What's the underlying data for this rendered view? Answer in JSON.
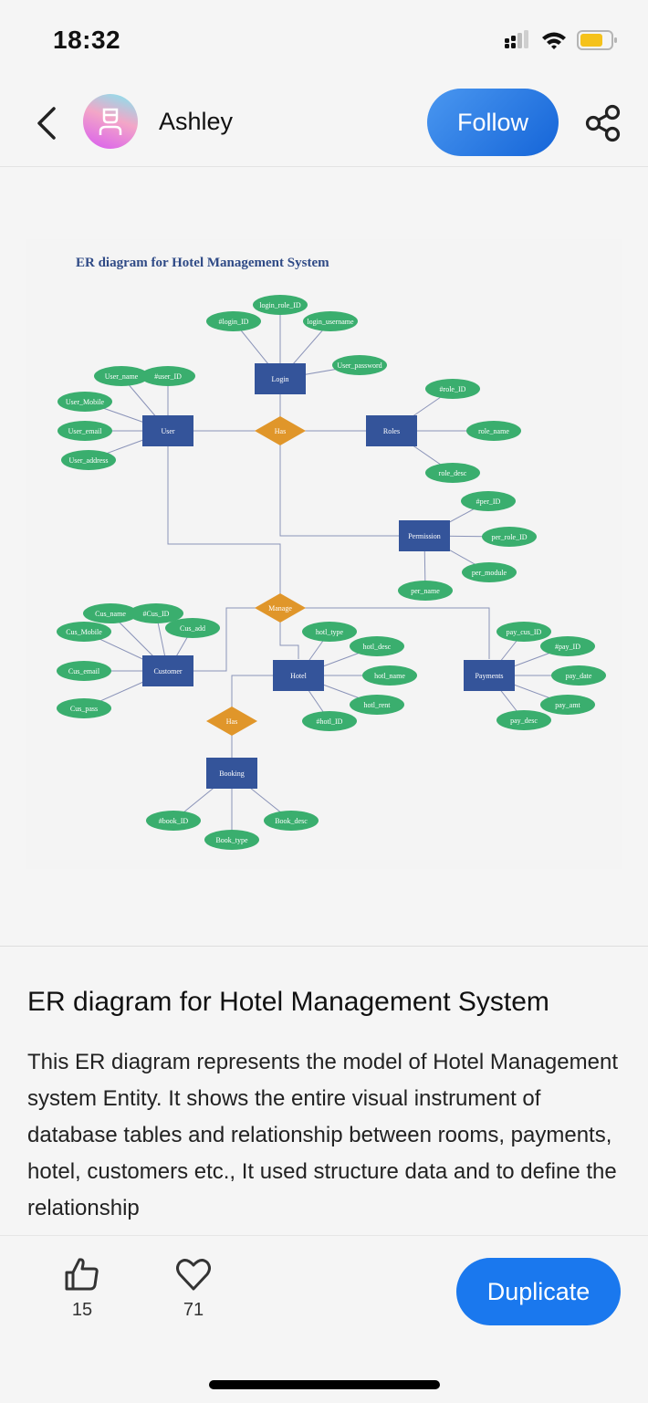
{
  "status_bar": {
    "time": "18:32",
    "signal_icon": "cellular-signal-icon",
    "wifi_icon": "wifi-icon",
    "battery_icon": "battery-icon",
    "battery_color": "#f5c21b"
  },
  "header": {
    "back_icon": "chevron-left-icon",
    "username": "Ashley",
    "follow_label": "Follow",
    "share_icon": "share-icon",
    "follow_color": "#1d6fe0"
  },
  "diagram": {
    "title": "ER diagram for Hotel Management System",
    "colors": {
      "entity": "#34549a",
      "relationship": "#e0962a",
      "attribute": "#3aae6e",
      "line": "#8a93b8",
      "title": "#2f4a86"
    },
    "entities": [
      {
        "id": "login",
        "label": "Login"
      },
      {
        "id": "user",
        "label": "User"
      },
      {
        "id": "roles",
        "label": "Roles"
      },
      {
        "id": "permission",
        "label": "Permission"
      },
      {
        "id": "customer",
        "label": "Customer"
      },
      {
        "id": "hotel",
        "label": "Hotel"
      },
      {
        "id": "payments",
        "label": "Payments"
      },
      {
        "id": "booking",
        "label": "Booking"
      }
    ],
    "relationships": [
      {
        "id": "has1",
        "label": "Has",
        "connects": [
          "user",
          "roles",
          "login",
          "permission"
        ]
      },
      {
        "id": "manage",
        "label": "Manage",
        "connects": [
          "user",
          "customer",
          "hotel",
          "payments"
        ]
      },
      {
        "id": "has2",
        "label": "Has",
        "connects": [
          "hotel",
          "booking"
        ]
      }
    ],
    "attributes": [
      {
        "entity": "login",
        "label": "#login_ID"
      },
      {
        "entity": "login",
        "label": "login_role_ID"
      },
      {
        "entity": "login",
        "label": "login_username"
      },
      {
        "entity": "login",
        "label": "User_password"
      },
      {
        "entity": "user",
        "label": "User_name"
      },
      {
        "entity": "user",
        "label": "#user_ID"
      },
      {
        "entity": "user",
        "label": "User_Mobile"
      },
      {
        "entity": "user",
        "label": "User_email"
      },
      {
        "entity": "user",
        "label": "User_address"
      },
      {
        "entity": "roles",
        "label": "#role_ID"
      },
      {
        "entity": "roles",
        "label": "role_name"
      },
      {
        "entity": "roles",
        "label": "role_desc"
      },
      {
        "entity": "permission",
        "label": "#per_ID"
      },
      {
        "entity": "permission",
        "label": "per_role_ID"
      },
      {
        "entity": "permission",
        "label": "per_module"
      },
      {
        "entity": "permission",
        "label": "per_name"
      },
      {
        "entity": "customer",
        "label": "Cus_name"
      },
      {
        "entity": "customer",
        "label": "#Cus_ID"
      },
      {
        "entity": "customer",
        "label": "Cus_add"
      },
      {
        "entity": "customer",
        "label": "Cus_Mobile"
      },
      {
        "entity": "customer",
        "label": "Cus_email"
      },
      {
        "entity": "customer",
        "label": "Cus_pass"
      },
      {
        "entity": "hotel",
        "label": "hotl_type"
      },
      {
        "entity": "hotel",
        "label": "hotl_desc"
      },
      {
        "entity": "hotel",
        "label": "hotl_name"
      },
      {
        "entity": "hotel",
        "label": "hotl_rent"
      },
      {
        "entity": "hotel",
        "label": "#hotl_ID"
      },
      {
        "entity": "payments",
        "label": "pay_cus_ID"
      },
      {
        "entity": "payments",
        "label": "#pay_ID"
      },
      {
        "entity": "payments",
        "label": "pay_date"
      },
      {
        "entity": "payments",
        "label": "pay_amt"
      },
      {
        "entity": "payments",
        "label": "pay_desc"
      },
      {
        "entity": "booking",
        "label": "#book_ID"
      },
      {
        "entity": "booking",
        "label": "Book_type"
      },
      {
        "entity": "booking",
        "label": "Book_desc"
      }
    ]
  },
  "content": {
    "title": "ER diagram for Hotel Management System",
    "description": "This ER diagram represents the model of Hotel Management system Entity. It shows the entire visual instrument of database tables and relationship between rooms, payments, hotel, customers etc., It used structure data and to define the relationship"
  },
  "bottom_bar": {
    "like_icon": "thumbs-up-icon",
    "like_count": "15",
    "favorite_icon": "heart-icon",
    "favorite_count": "71",
    "duplicate_label": "Duplicate"
  }
}
